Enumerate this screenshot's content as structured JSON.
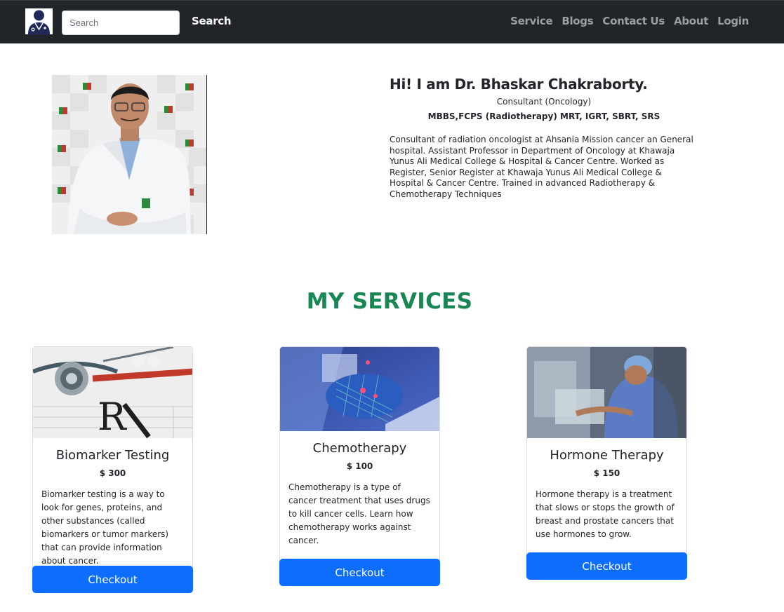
{
  "nav": {
    "search_placeholder": "Search",
    "search_label": "Search",
    "links": [
      "Service",
      "Blogs",
      "Contact Us",
      "About",
      "Login"
    ]
  },
  "profile": {
    "greeting": "Hi! I am Dr. Bhaskar Chakraborty.",
    "role": "Consultant (Oncology)",
    "degrees": "MBBS,FCPS (Radiotherapy) MRT, IGRT, SBRT, SRS",
    "bio": "Consultant of radiation oncologist at Ahsania Mission cancer an General hospital. Assistant Professor in Department of Oncology at Khawaja Yunus Ali Medical College & Hospital & Cancer Centre. Worked as Register, Senior Register at Khawaja Yunus Ali Medical College & Hospital & Cancer Centre. Trained in advanced Radiotherapy & Chemotherapy Techniques"
  },
  "services": {
    "heading": "MY SERVICES",
    "items": [
      {
        "title": "Biomarker Testing",
        "price": "$ 300",
        "description": "Biomarker testing is a way to look for genes, proteins, and other substances (called biomarkers or tumor markers) that can provide information about cancer.",
        "button": "Checkout"
      },
      {
        "title": "Chemotherapy",
        "price": "$ 100",
        "description": "Chemotherapy is a type of cancer treatment that uses drugs to kill cancer cells. Learn how chemotherapy works against cancer.",
        "button": "Checkout"
      },
      {
        "title": "Hormone Therapy",
        "price": "$ 150",
        "description": "Hormone therapy is a treatment that slows or stops the growth of breast and prostate cancers that use hormones to grow.",
        "button": "Checkout"
      }
    ]
  },
  "colors": {
    "navbar": "#212529",
    "accent_green": "#198754",
    "button_blue": "#0d6efd"
  }
}
